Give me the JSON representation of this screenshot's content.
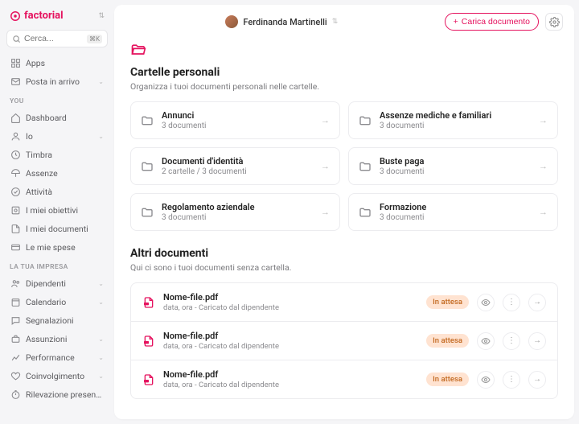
{
  "brand": "factorial",
  "search": {
    "placeholder": "Cerca...",
    "shortcut": "⌘K"
  },
  "nav": {
    "apps": "Apps",
    "inbox": "Posta in arrivo",
    "group_you": "YOU",
    "dashboard": "Dashboard",
    "io": "Io",
    "timbra": "Timbra",
    "assenze": "Assenze",
    "attivita": "Attività",
    "obiettivi": "I miei obiettivi",
    "documenti": "I miei documenti",
    "spese": "Le mie spese",
    "group_company": "LA TUA IMPRESA",
    "dipendenti": "Dipendenti",
    "calendario": "Calendario",
    "segnalazioni": "Segnalazioni",
    "assunzioni": "Assunzioni",
    "performance": "Performance",
    "coinvolgimento": "Coinvolgimento",
    "rilevazione": "Rilevazione presenze"
  },
  "header": {
    "user": "Ferdinanda Martinelli",
    "upload": "Carica documento"
  },
  "personal": {
    "title": "Cartelle personali",
    "subtitle": "Organizza i tuoi documenti personali nelle cartelle.",
    "folders": [
      {
        "name": "Annunci",
        "meta": "3 documenti"
      },
      {
        "name": "Assenze mediche e familiari",
        "meta": "3 documenti"
      },
      {
        "name": "Documenti d'identità",
        "meta": "2 cartelle / 3 documenti"
      },
      {
        "name": "Buste paga",
        "meta": "3 documenti"
      },
      {
        "name": "Regolamento aziendale",
        "meta": "3 documenti"
      },
      {
        "name": "Formazione",
        "meta": "3 documenti"
      }
    ]
  },
  "other": {
    "title": "Altri documenti",
    "subtitle": "Qui ci sono i tuoi documenti senza cartella.",
    "badge": "In attesa",
    "docs": [
      {
        "name": "Nome-file.pdf",
        "meta": "data, ora - Caricato dal dipendente"
      },
      {
        "name": "Nome-file.pdf",
        "meta": "data, ora - Caricato dal dipendente"
      },
      {
        "name": "Nome-file.pdf",
        "meta": "data, ora - Caricato dal dipendente"
      }
    ]
  }
}
